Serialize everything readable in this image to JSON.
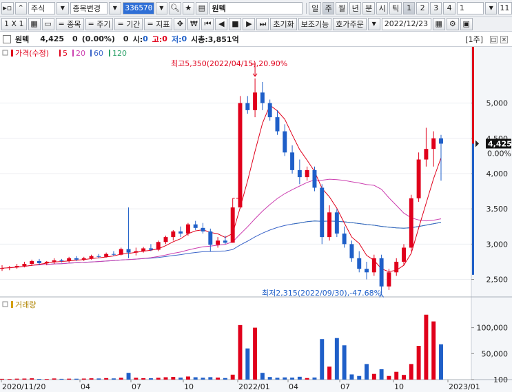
{
  "toolbar1": {
    "market": "주식",
    "change_stock": "종목변경",
    "code": "336570",
    "stock_name": "원텍",
    "periods": [
      "일",
      "주",
      "월",
      "년",
      "분",
      "시",
      "틱"
    ],
    "active_period": "주",
    "numbers": [
      "1",
      "2",
      "3",
      "4"
    ],
    "active_number": "1",
    "select_value": "1",
    "right_value": "11"
  },
  "toolbar2": {
    "layout": "1 X 1",
    "stock_btn": "종목",
    "period_btn": "주기",
    "term_btn": "기간",
    "indicator_btn": "지표",
    "won_icon": "₩",
    "reset": "초기화",
    "aux": "보조기능",
    "quote": "호가주문",
    "date": "2022/12/23"
  },
  "info": {
    "name": "원텍",
    "price": "4,425",
    "change": "0",
    "change_pct": "(0.00%)",
    "volume": "0",
    "open_label": "시:",
    "open_val": "0",
    "high_label": "고:",
    "high_val": "0",
    "low_label": "저:",
    "low_val": "0",
    "mcap_label": "시총:",
    "mcap_val": "3,851억",
    "unit_tag": "[1주]"
  },
  "colors": {
    "up": "#e0001b",
    "down": "#1f5fc8",
    "ma5": "#e0001b",
    "ma20": "#cc3fb0",
    "ma60": "#3a64c9",
    "ma120": "#2ea36a"
  },
  "chart_data": [
    {
      "type": "candlestick",
      "legend": [
        "가격(수정)",
        "5",
        "20",
        "60",
        "120"
      ],
      "yticks": [
        "5,000",
        "4,500",
        "4,000",
        "3,500",
        "3,000",
        "2,500"
      ],
      "ylim": [
        2300,
        5700
      ],
      "xticks": [
        "2020/11/20",
        "04",
        "07",
        "10",
        "2022/01",
        "04",
        "07",
        "10",
        "2023/01"
      ],
      "current_price": "4,425",
      "current_pct": "0.00%",
      "annotation_high": "최고5,350(2022/04/15),20.90%",
      "annotation_low": "최저2,315(2022/09/30),-47.68%",
      "candles": [
        [
          2650,
          2700,
          2620,
          2660
        ],
        [
          2660,
          2690,
          2630,
          2670
        ],
        [
          2670,
          2720,
          2650,
          2690
        ],
        [
          2690,
          2750,
          2670,
          2720
        ],
        [
          2720,
          2780,
          2690,
          2760
        ],
        [
          2760,
          2790,
          2700,
          2730
        ],
        [
          2730,
          2760,
          2700,
          2750
        ],
        [
          2750,
          2800,
          2720,
          2770
        ],
        [
          2770,
          2790,
          2740,
          2760
        ],
        [
          2760,
          2820,
          2740,
          2800
        ],
        [
          2800,
          2830,
          2760,
          2780
        ],
        [
          2780,
          2820,
          2760,
          2800
        ],
        [
          2800,
          2850,
          2780,
          2830
        ],
        [
          2830,
          2860,
          2800,
          2820
        ],
        [
          2820,
          2880,
          2810,
          2860
        ],
        [
          2860,
          2900,
          2830,
          2850
        ],
        [
          2850,
          2950,
          2840,
          2930
        ],
        [
          2930,
          3520,
          2800,
          2880
        ],
        [
          2880,
          2950,
          2840,
          2900
        ],
        [
          2900,
          2960,
          2880,
          2940
        ],
        [
          2940,
          3000,
          2900,
          2920
        ],
        [
          2920,
          3050,
          2900,
          3030
        ],
        [
          3030,
          3120,
          3000,
          3100
        ],
        [
          3100,
          3200,
          3050,
          3180
        ],
        [
          3180,
          3250,
          3100,
          3150
        ],
        [
          3150,
          3300,
          3120,
          3280
        ],
        [
          3280,
          3330,
          3200,
          3230
        ],
        [
          3230,
          3300,
          3150,
          3180
        ],
        [
          3180,
          3220,
          2900,
          2990
        ],
        [
          2990,
          3100,
          2950,
          3050
        ],
        [
          3050,
          3120,
          3000,
          3020
        ],
        [
          3020,
          3650,
          3020,
          3520
        ],
        [
          3520,
          5100,
          3500,
          5000
        ],
        [
          5000,
          5100,
          4850,
          4900
        ],
        [
          4900,
          5350,
          4800,
          5150
        ],
        [
          5150,
          5300,
          4900,
          5000
        ],
        [
          5000,
          5050,
          4750,
          4800
        ],
        [
          4800,
          4900,
          4550,
          4600
        ],
        [
          4600,
          4700,
          4250,
          4300
        ],
        [
          4300,
          4400,
          4000,
          4050
        ],
        [
          4050,
          4200,
          3850,
          3950
        ],
        [
          3950,
          4100,
          3900,
          4050
        ],
        [
          4050,
          4100,
          3750,
          3800
        ],
        [
          3800,
          3850,
          3000,
          3100
        ],
        [
          3100,
          3550,
          3050,
          3450
        ],
        [
          3450,
          3500,
          3100,
          3150
        ],
        [
          3150,
          3250,
          2950,
          3000
        ],
        [
          3000,
          3050,
          2750,
          2800
        ],
        [
          2800,
          2900,
          2600,
          2650
        ],
        [
          2650,
          2750,
          2500,
          2600
        ],
        [
          2600,
          2850,
          2550,
          2800
        ],
        [
          2800,
          2850,
          2315,
          2400
        ],
        [
          2400,
          2650,
          2350,
          2600
        ],
        [
          2600,
          2800,
          2550,
          2750
        ],
        [
          2750,
          3000,
          2700,
          2950
        ],
        [
          2950,
          3700,
          2900,
          3650
        ],
        [
          3650,
          4300,
          3600,
          4200
        ],
        [
          4200,
          4650,
          4100,
          4350
        ],
        [
          4350,
          4600,
          4100,
          4500
        ],
        [
          4500,
          4550,
          3900,
          4425
        ]
      ]
    },
    {
      "type": "bar",
      "legend": [
        "거래량"
      ],
      "yticks": [
        "100,000",
        "50,000",
        "100"
      ],
      "ylim": [
        0,
        130000
      ],
      "values": [
        1500,
        1200,
        1800,
        2000,
        2500,
        1300,
        1200,
        2200,
        1500,
        1800,
        1700,
        2000,
        2500,
        2200,
        2900,
        2300,
        3500,
        13000,
        3500,
        2800,
        2600,
        3500,
        4500,
        5200,
        3800,
        6000,
        4500,
        3600,
        4700,
        3800,
        3000,
        9500,
        105000,
        60000,
        100000,
        13000,
        5000,
        3500,
        4200,
        3800,
        5500,
        3000,
        4000,
        78000,
        25000,
        80000,
        66000,
        10000,
        7000,
        30000,
        11000,
        20000,
        7000,
        15000,
        9000,
        30000,
        65000,
        125000,
        112000,
        68000
      ]
    }
  ]
}
